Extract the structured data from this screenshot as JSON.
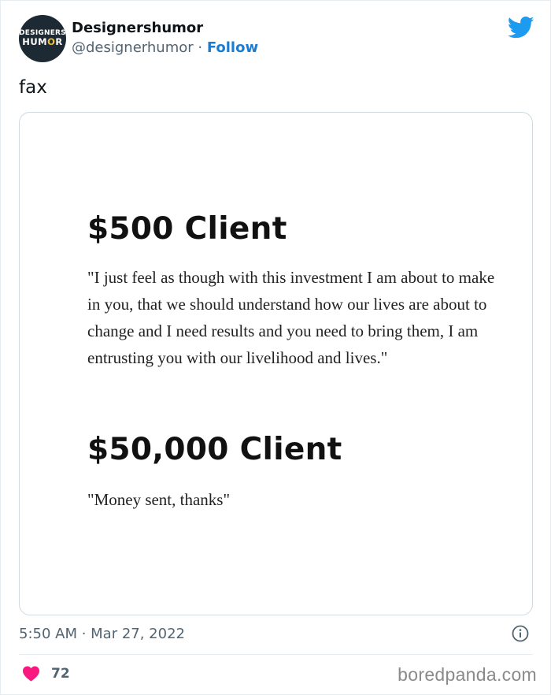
{
  "author": {
    "display_name": "Designershumor",
    "handle": "@designerhumor",
    "separator": " · ",
    "follow_label": "Follow",
    "avatar_line1": "DESIGNERS",
    "avatar_line2_a": "HUM",
    "avatar_line2_o": "O",
    "avatar_line2_b": "R"
  },
  "tweet": {
    "text": "fax",
    "timestamp": "5:50 AM · Mar 27, 2022",
    "like_count": "72"
  },
  "media": {
    "heading1": "$500 Client",
    "quote1": "\"I just feel as though with this investment I am about to make in you, that we should understand how our lives are about to change and I need results and you need to bring them, I am entrusting you with our livelihood and lives.\"",
    "heading2": "$50,000 Client",
    "quote2": "\"Money sent, thanks\""
  },
  "watermark": "boredpanda.com",
  "colors": {
    "twitter_blue": "#1d9bf0",
    "follow_blue": "#1b7dcf",
    "like_pink": "#f91880",
    "muted_text": "#536471"
  },
  "icons": [
    "twitter-bird-icon",
    "info-icon",
    "heart-icon"
  ]
}
